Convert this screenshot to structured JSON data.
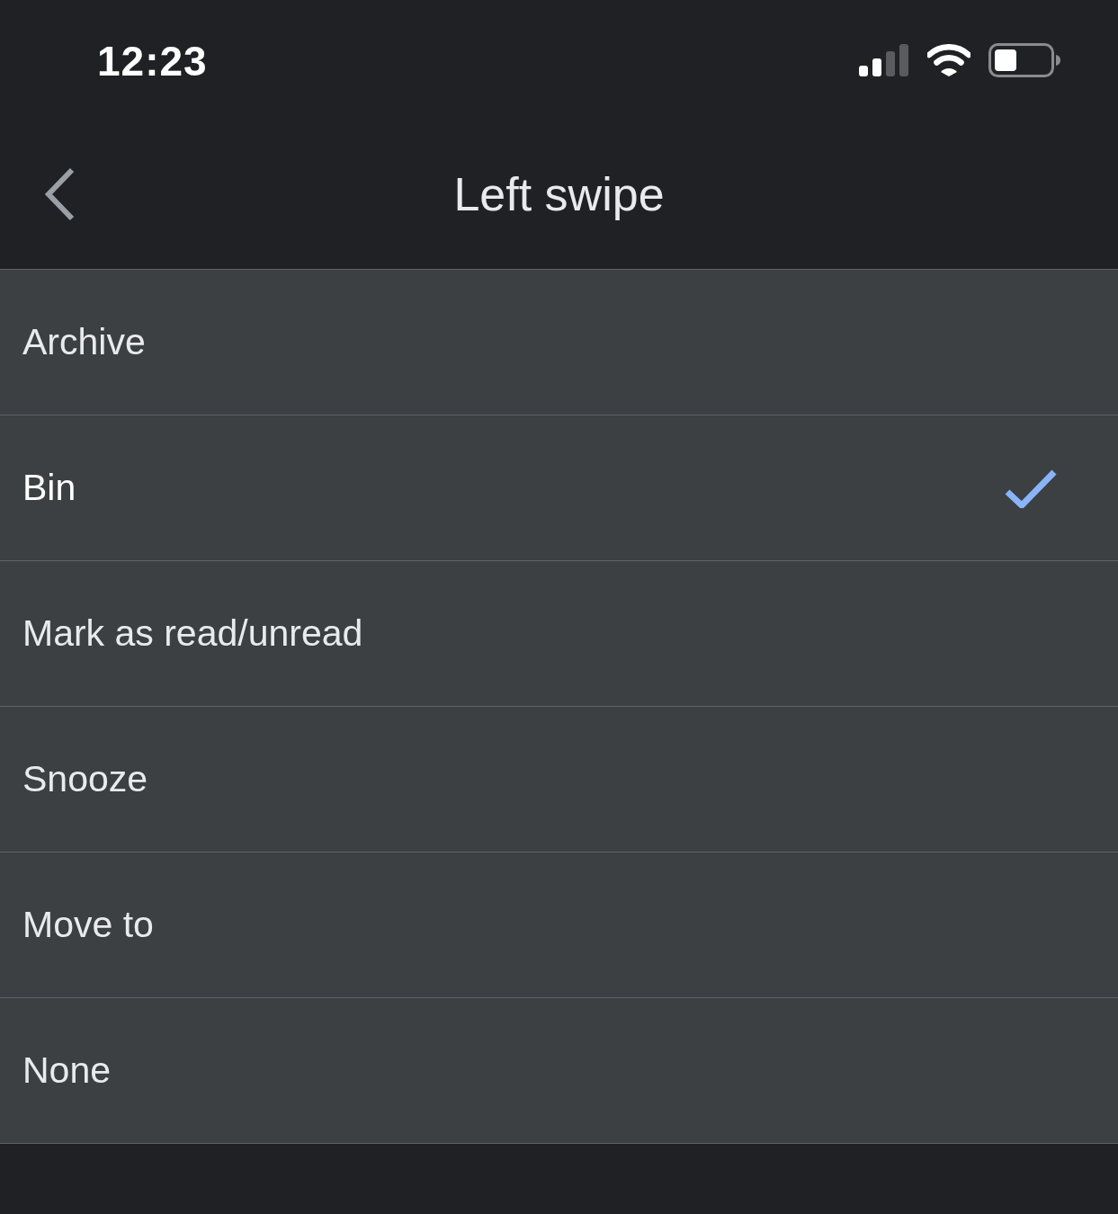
{
  "status_bar": {
    "time": "12:23"
  },
  "header": {
    "title": "Left swipe"
  },
  "options": [
    {
      "label": "Archive",
      "selected": false
    },
    {
      "label": "Bin",
      "selected": true
    },
    {
      "label": "Mark as read/unread",
      "selected": false
    },
    {
      "label": "Snooze",
      "selected": false
    },
    {
      "label": "Move to",
      "selected": false
    },
    {
      "label": "None",
      "selected": false
    }
  ]
}
